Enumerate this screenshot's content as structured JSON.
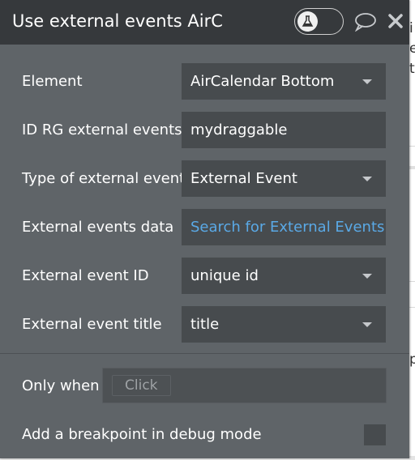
{
  "window": {
    "title": "Use external events AirC"
  },
  "background": {
    "fragments": [
      "i",
      "e",
      "t",
      "p"
    ]
  },
  "fields": [
    {
      "label": "Element",
      "value": "AirCalendar Bottom",
      "dropdown": true
    },
    {
      "label": "ID RG external events",
      "value": "mydraggable",
      "dropdown": false
    },
    {
      "label": "Type of external event",
      "value": "External Event",
      "dropdown": true
    },
    {
      "label": "External events data",
      "value": "Search for External Events",
      "dropdown": false,
      "link": true
    },
    {
      "label": "External event ID",
      "value": "unique id",
      "dropdown": true
    },
    {
      "label": "External event title",
      "value": "title",
      "dropdown": true
    }
  ],
  "only_when": {
    "label": "Only when",
    "chip": "Click"
  },
  "breakpoint": {
    "label": "Add a breakpoint in debug mode",
    "checked": false
  },
  "colors": {
    "panel": "#5f6468",
    "header": "#36393c",
    "field": "#474b4e",
    "link": "#5aa9e6"
  }
}
